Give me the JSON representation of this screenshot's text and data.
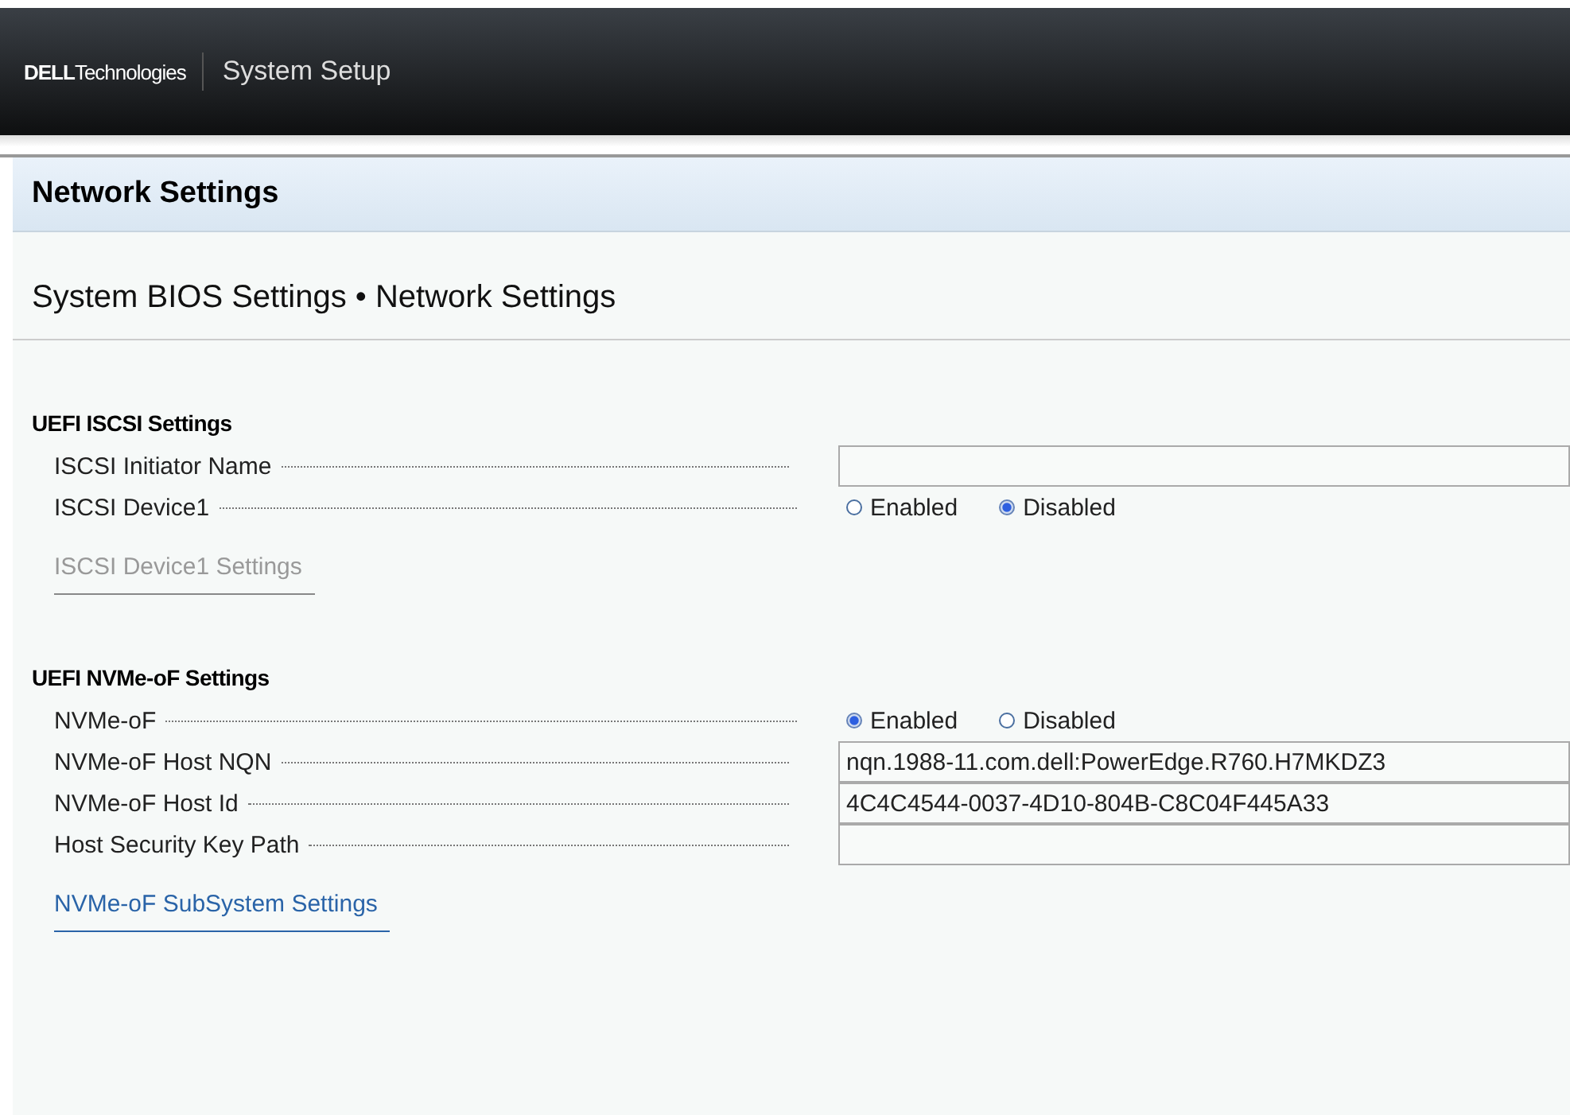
{
  "header": {
    "logo_brand": "DELL",
    "logo_suffix": "Technologies",
    "title": "System Setup"
  },
  "page_title": "Network Settings",
  "breadcrumb": "System BIOS Settings • Network Settings",
  "sections": [
    {
      "title": "UEFI ISCSI Settings",
      "rows": [
        {
          "kind": "text",
          "label": "ISCSI Initiator Name"
        },
        {
          "kind": "radio",
          "label": "ISCSI Device1",
          "options": [
            {
              "label": "Enabled",
              "selected": false
            },
            {
              "label": "Disabled",
              "selected": true
            }
          ]
        }
      ],
      "link": {
        "label": "ISCSI Device1 Settings",
        "disabled": true
      }
    },
    {
      "title": "UEFI NVMe-oF Settings",
      "rows": [
        {
          "kind": "radio",
          "label": "NVMe-oF",
          "options": [
            {
              "label": "Enabled",
              "selected": true
            },
            {
              "label": "Disabled",
              "selected": false
            }
          ]
        },
        {
          "kind": "text",
          "label": "NVMe-oF Host NQN",
          "value": "nqn.1988-11.com.dell:PowerEdge.R760.H7MKDZ3"
        },
        {
          "kind": "text",
          "label": "NVMe-oF Host Id",
          "value": "4C4C4544-0037-4D10-804B-C8C04F445A33"
        },
        {
          "kind": "text",
          "label": "Host Security Key Path"
        }
      ],
      "link": {
        "label": "NVMe-oF SubSystem Settings",
        "disabled": false
      }
    }
  ]
}
